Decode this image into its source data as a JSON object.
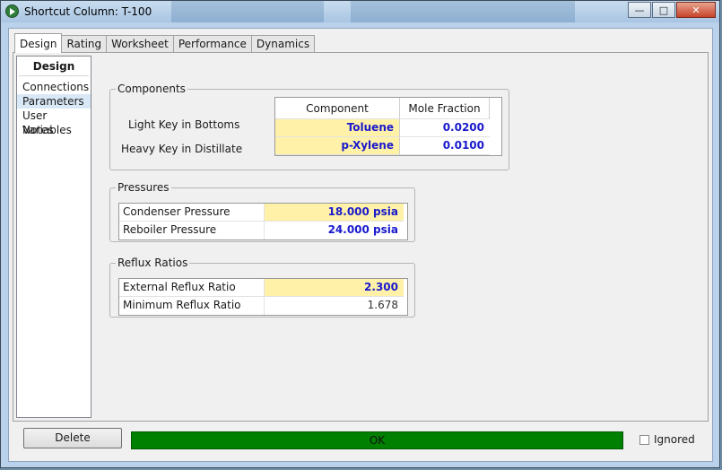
{
  "window": {
    "title": "Shortcut Column: T-100"
  },
  "tabs": [
    "Design",
    "Rating",
    "Worksheet",
    "Performance",
    "Dynamics"
  ],
  "nav": {
    "header": "Design",
    "items": [
      "Connections",
      "Parameters",
      "User Variables",
      "Notes"
    ],
    "selected": "Parameters"
  },
  "components": {
    "group_label": "Components",
    "col_component": "Component",
    "col_mole_fraction": "Mole Fraction",
    "rows": [
      {
        "label": "Light Key in Bottoms",
        "component": "Toluene",
        "mole_fraction": "0.0200"
      },
      {
        "label": "Heavy Key in Distillate",
        "component": "p-Xylene",
        "mole_fraction": "0.0100"
      }
    ]
  },
  "pressures": {
    "group_label": "Pressures",
    "rows": [
      {
        "label": "Condenser Pressure",
        "value": "18.000 psia"
      },
      {
        "label": "Reboiler Pressure",
        "value": "24.000 psia"
      }
    ]
  },
  "reflux": {
    "group_label": "Reflux Ratios",
    "rows": [
      {
        "label": "External Reflux Ratio",
        "value": "2.300"
      },
      {
        "label": "Minimum Reflux Ratio",
        "value": "1.678"
      }
    ]
  },
  "footer": {
    "delete_label": "Delete",
    "status_text": "OK",
    "status_color": "#008000",
    "ignored_label": "Ignored"
  },
  "colors": {
    "input_fill": "#fff2a8",
    "value_text": "#1a1acc"
  }
}
